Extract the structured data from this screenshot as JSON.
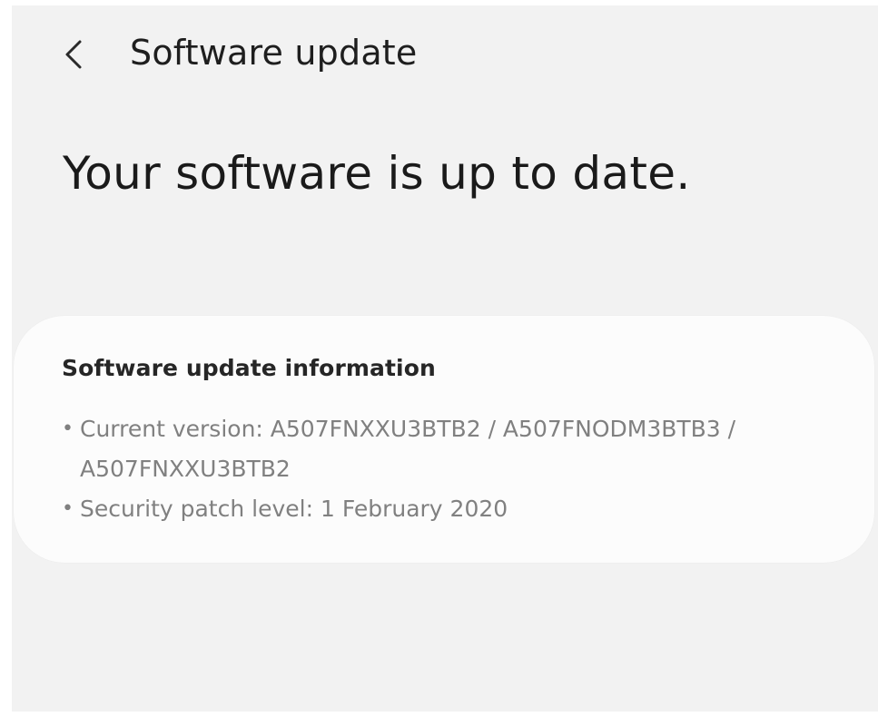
{
  "app_bar": {
    "title": "Software update",
    "back_icon": "chevron-left-icon"
  },
  "status": {
    "heading": "Your software is up to date."
  },
  "info_card": {
    "title": "Software update information",
    "bullet": "•",
    "items": [
      {
        "label": "Current version: ",
        "value": "A507FNXXU3BTB2 / A507FNODM3BTB3 / A507FNXXU3BTB2"
      },
      {
        "label": "Security patch level: ",
        "value": "1 February 2020"
      }
    ]
  },
  "colors": {
    "background": "#f2f2f2",
    "card": "#fcfcfc",
    "primary_text": "#1e1e1e",
    "secondary_text": "#808080"
  }
}
